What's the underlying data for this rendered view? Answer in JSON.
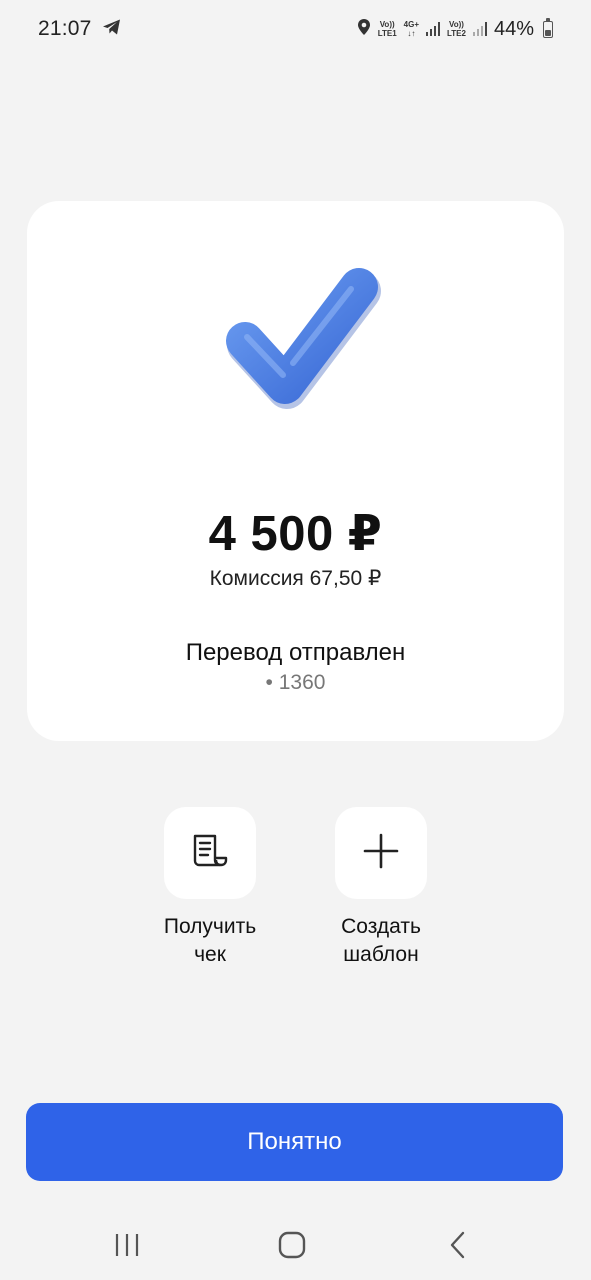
{
  "status_bar": {
    "time": "21:07",
    "sim1_top": "Vo))",
    "sim1_bottom": "LTE1",
    "net_type": "4G+",
    "sim2_top": "Vo))",
    "sim2_bottom": "LTE2",
    "battery": "44%",
    "battery_level": 0.44,
    "icons": [
      "telegram-icon",
      "location-icon",
      "signal-icon",
      "battery-icon"
    ]
  },
  "card": {
    "icon": "checkmark-icon",
    "amount": "4 500 ₽",
    "commission": "Комиссия 67,50 ₽",
    "status": "Перевод отправлен",
    "account": "• 1360"
  },
  "actions": {
    "receipt": {
      "icon": "receipt-icon",
      "line1": "Получить",
      "line2": "чек"
    },
    "template": {
      "icon": "plus-icon",
      "line1": "Создать",
      "line2": "шаблон"
    }
  },
  "primary_button": {
    "label": "Понятно"
  },
  "nav": {
    "icons": [
      "recents-icon",
      "home-icon",
      "back-icon"
    ]
  },
  "colors": {
    "accent": "#2f63e8",
    "background": "#f3f3f3",
    "check": "#4a7fe0"
  }
}
